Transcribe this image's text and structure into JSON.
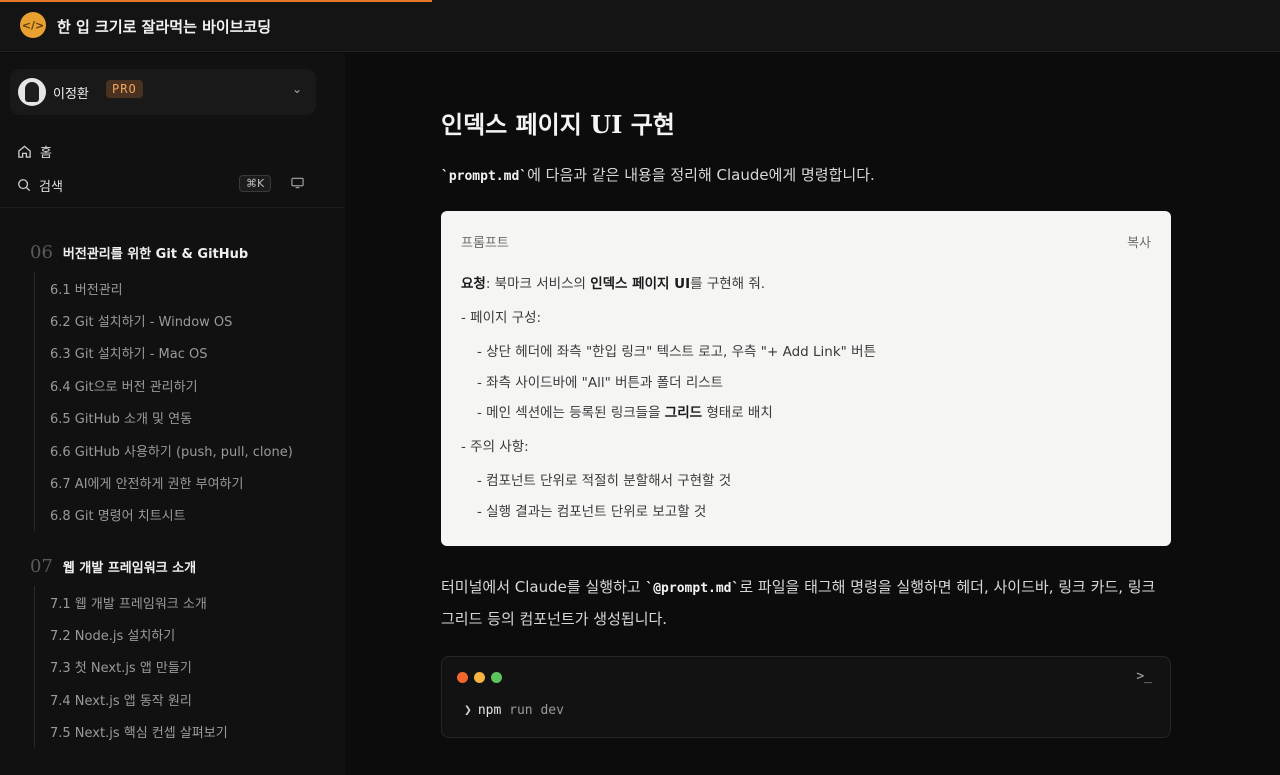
{
  "app": {
    "title": "한 입 크기로 잘라먹는 바이브코딩",
    "accent_color": "#e8772a"
  },
  "user": {
    "name": "이정환",
    "plan": "PRO"
  },
  "nav": {
    "home": "홈",
    "search": "검색",
    "search_shortcut": "⌘K"
  },
  "chapters": [
    {
      "number": "06",
      "title": "버전관리를 위한 Git & GitHub",
      "lessons": [
        "6.1 버전관리",
        "6.2 Git 설치하기 - Window OS",
        "6.3 Git 설치하기 - Mac OS",
        "6.4 Git으로 버전 관리하기",
        "6.5 GitHub 소개 및 연동",
        "6.6 GitHub 사용하기 (push, pull, clone)",
        "6.7 AI에게 안전하게 권한 부여하기",
        "6.8 Git 명령어 치트시트"
      ]
    },
    {
      "number": "07",
      "title": "웹 개발 프레임워크 소개",
      "lessons": [
        "7.1 웹 개발 프레임워크 소개",
        "7.2 Node.js 설치하기",
        "7.3 첫 Next.js 앱 만들기",
        "7.4 Next.js 앱 동작 원리",
        "7.5 Next.js 핵심 컨셉 살펴보기"
      ]
    }
  ],
  "content": {
    "heading": "인덱스 페이지 UI 구현",
    "intro": {
      "code": "`prompt.md`",
      "text": "에 다음과 같은 내용을 정리해 Claude에게 명령합니다."
    },
    "prompt_box": {
      "label": "프롬프트",
      "copy": "복사",
      "request_label": "요청",
      "request_a": ": 북마크 서비스의 ",
      "request_bold": "인덱스 페이지 UI",
      "request_b": "를 구현해 줘.",
      "section1": "-  페이지 구성:",
      "item1": "-  상단 헤더에 좌측 \"한입 링크\" 텍스트 로고, 우측 \"+ Add Link\" 버튼",
      "item2": "-  좌측 사이드바에 \"All\" 버튼과 폴더 리스트",
      "item3_a": "-  메인 섹션에는 등록된 링크들을 ",
      "item3_bold": "그리드",
      "item3_b": " 형태로 배치",
      "section2": "-  주의 사항:",
      "item4": "-  컴포넌트 단위로 적절히 분할해서 구현할 것",
      "item5": "-  실행 결과는 컴포넌트 단위로 보고할 것"
    },
    "after": {
      "text_a": "터미널에서 Claude를 실행하고 ",
      "code": "`@prompt.md`",
      "text_b": "로 파일을 태그해 명령을 실행하면 헤더, 사이드바, 링크 카드, 링크 그리드 등의 컴포넌트가 생성됩니다."
    },
    "terminal": {
      "prompt_symbol": "❯",
      "command": "npm",
      "args": "run dev",
      "icon": "terminal-icon",
      "dot_colors": [
        "#f2662d",
        "#f5b342",
        "#5cc45e"
      ]
    }
  }
}
